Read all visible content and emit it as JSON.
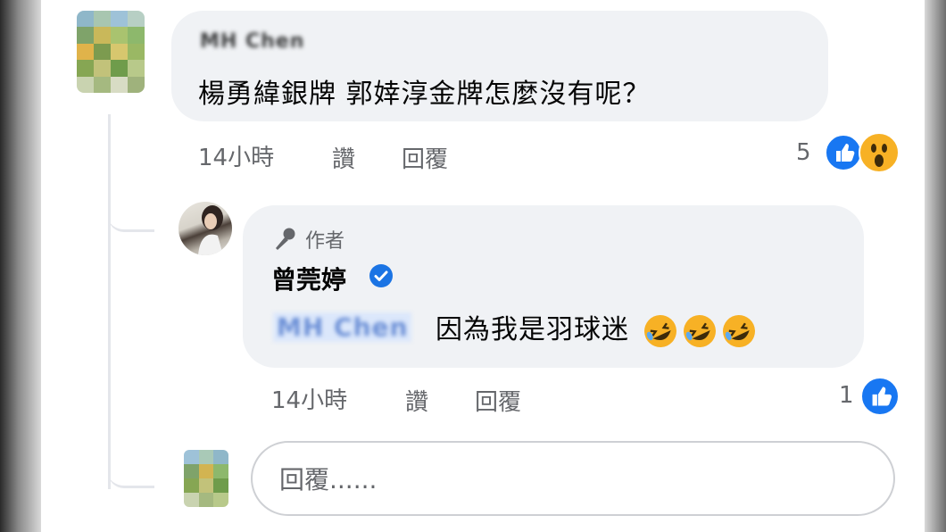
{
  "comment": {
    "author_blurred": "MH Chen",
    "text": "楊勇緯銀牌 郭婞淳金牌怎麼沒有呢？",
    "time": "14小時",
    "like_label": "讚",
    "reply_label": "回覆",
    "reaction_count": "5",
    "reactions": [
      "like-icon",
      "wow-icon"
    ]
  },
  "reply": {
    "badge_label": "作者",
    "badge_icon": "microphone-icon",
    "author": "曾莞婷",
    "verified_icon": "verified-badge-icon",
    "mention_blurred": "MH Chen",
    "text": "因為我是羽球迷",
    "emojis": [
      "rofl-emoji",
      "rofl-emoji",
      "rofl-emoji"
    ],
    "time": "14小時",
    "like_label": "讚",
    "reply_label": "回覆",
    "reaction_count": "1",
    "reactions": [
      "like-icon"
    ]
  },
  "reply_box": {
    "placeholder": "回覆......"
  },
  "colors": {
    "bubble_bg": "#f0f2f5",
    "meta_text": "#65676b",
    "mention_blue": "#1b74e4",
    "like_blue": "#1877f2",
    "wow_yellow": "#f7b125"
  }
}
